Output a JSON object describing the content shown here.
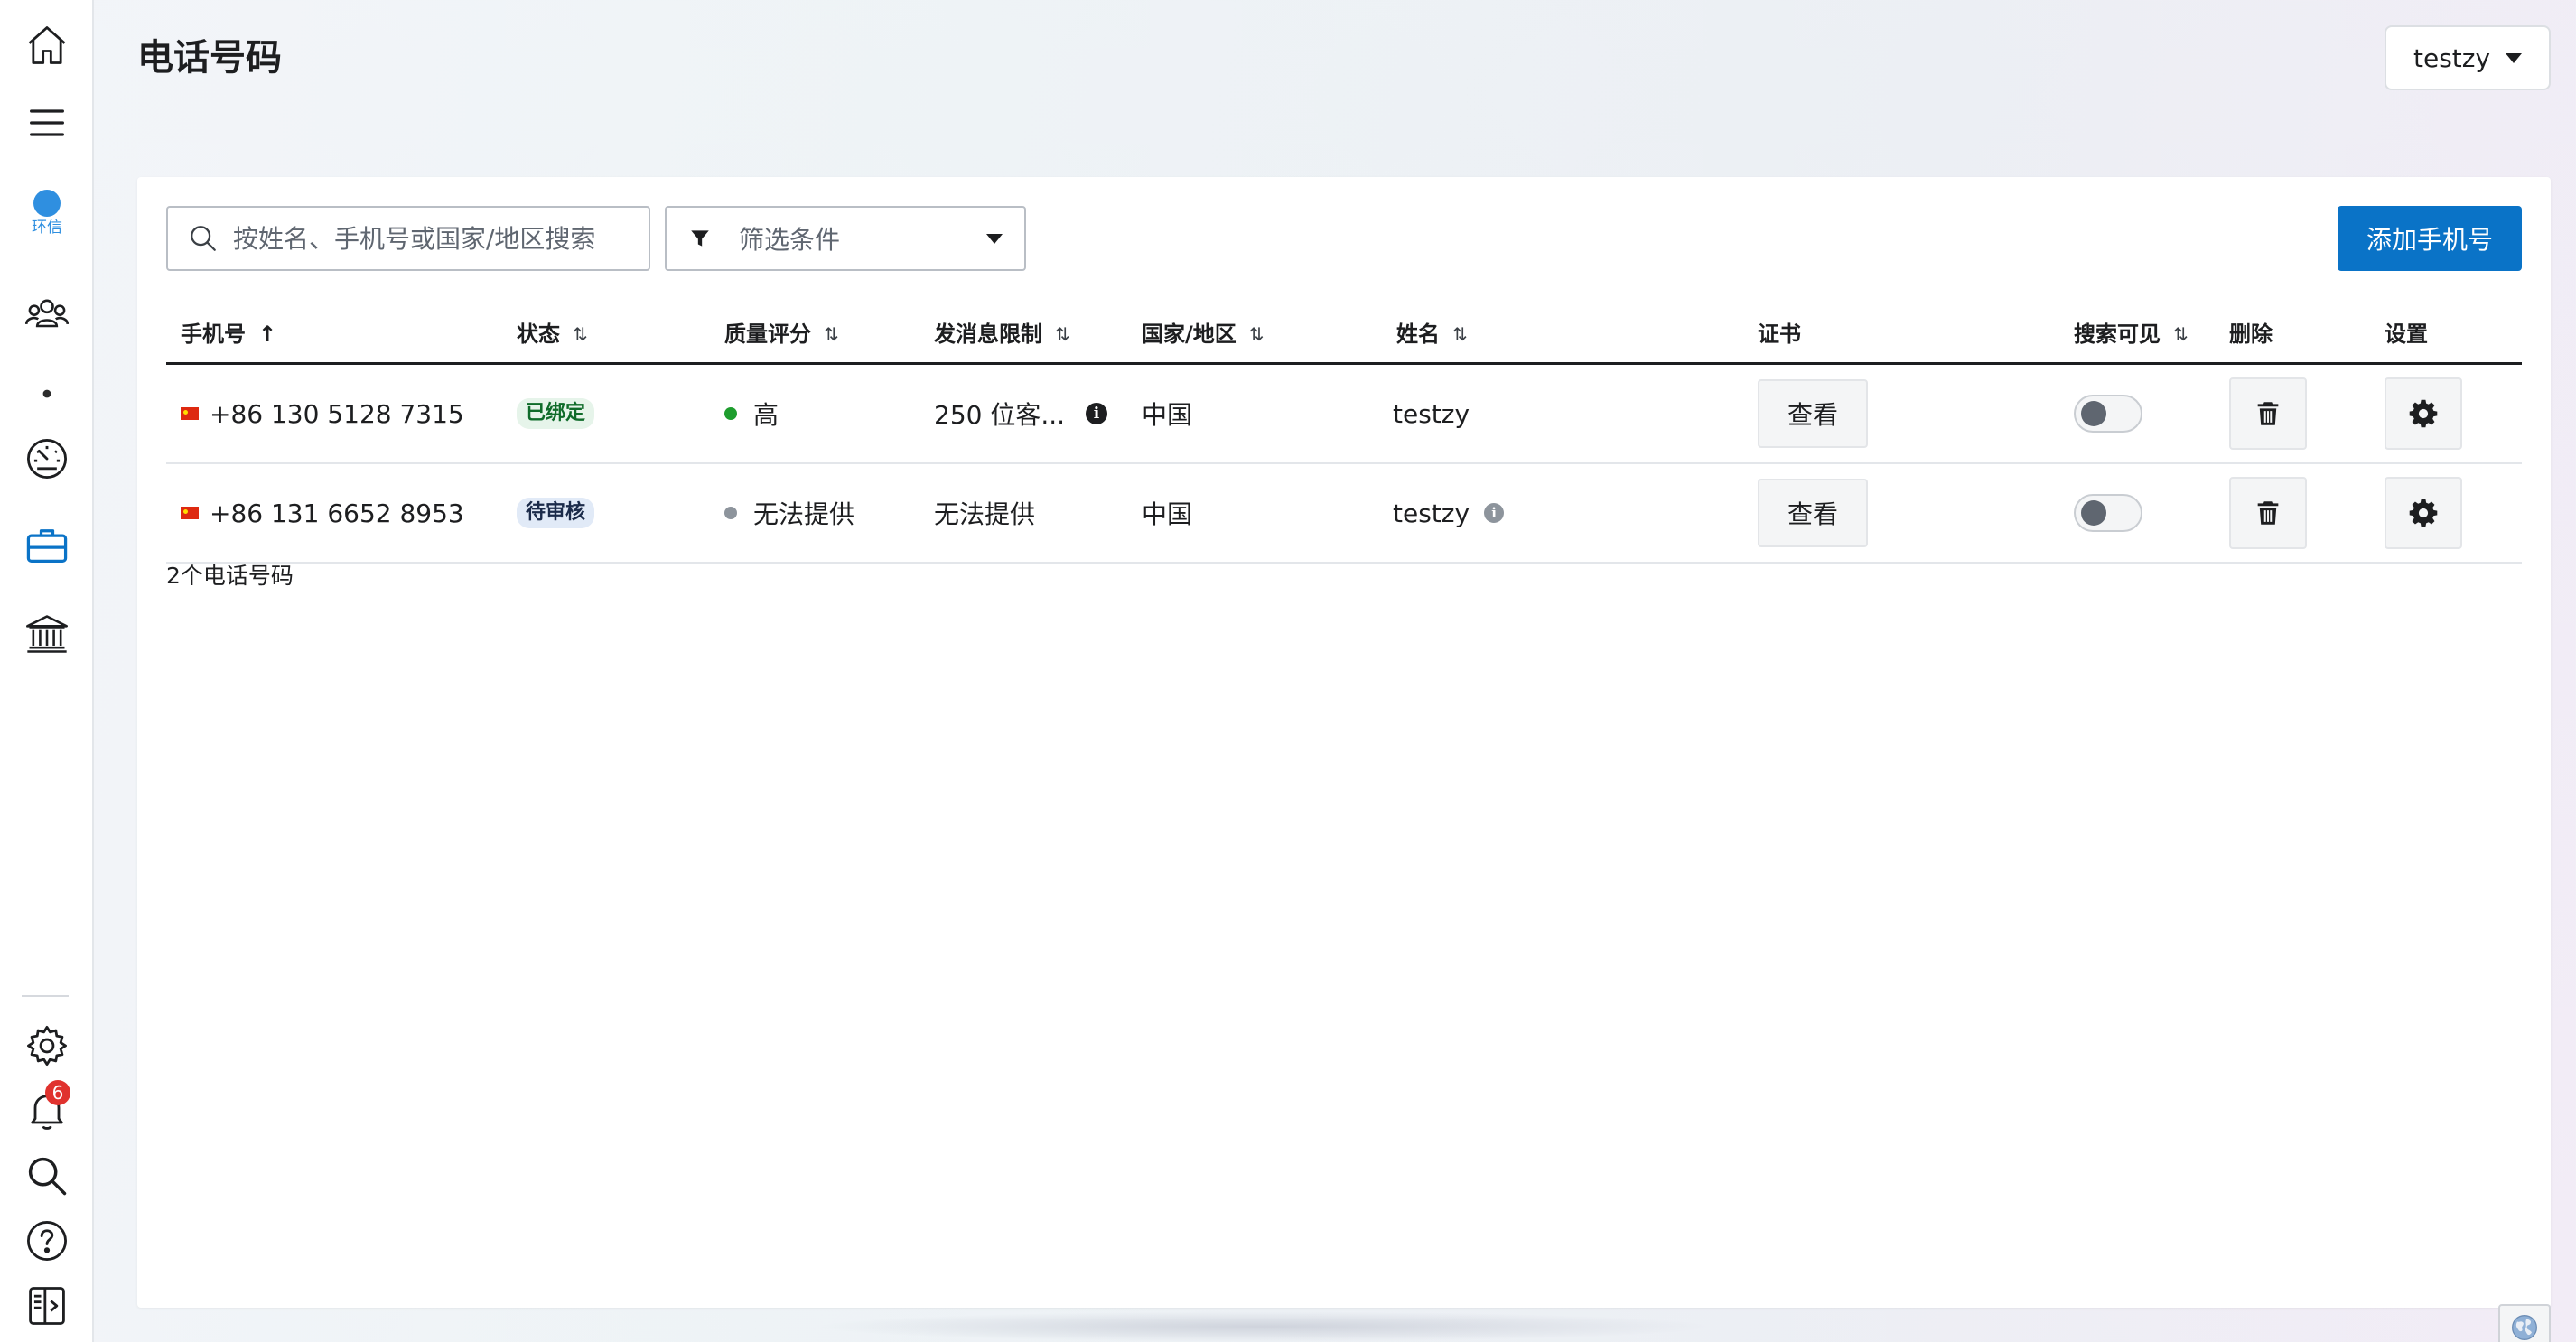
{
  "header": {
    "title": "电话号码",
    "account": "testzy"
  },
  "sidebar": {
    "brand_text": "环信",
    "notification_count": "6",
    "items": [
      {
        "name": "home",
        "icon": "home-icon"
      },
      {
        "name": "menu",
        "icon": "menu-icon"
      },
      {
        "name": "brand",
        "icon": "brand-logo"
      },
      {
        "name": "contacts",
        "icon": "users-icon"
      },
      {
        "name": "dashboard",
        "icon": "gauge-icon"
      },
      {
        "name": "tools",
        "icon": "briefcase-icon"
      },
      {
        "name": "bank",
        "icon": "bank-icon"
      },
      {
        "name": "settings",
        "icon": "gear-icon"
      },
      {
        "name": "notifications",
        "icon": "bell-icon"
      },
      {
        "name": "search",
        "icon": "search-icon"
      },
      {
        "name": "help",
        "icon": "help-icon"
      },
      {
        "name": "toggle-panel",
        "icon": "panel-icon"
      }
    ]
  },
  "toolbar": {
    "search_placeholder": "按姓名、手机号或国家/地区搜索",
    "filter_label": "筛选条件",
    "add_label": "添加手机号"
  },
  "table": {
    "columns": {
      "phone": "手机号",
      "status": "状态",
      "quality": "质量评分",
      "limit": "发消息限制",
      "country": "国家/地区",
      "name": "姓名",
      "cert": "证书",
      "searchable": "搜索可见",
      "delete": "删除",
      "settings": "设置"
    },
    "rows": [
      {
        "phone": "+86 130 5128 7315",
        "status": "已绑定",
        "quality": "高",
        "limit": "250 位客...",
        "country": "中国",
        "name": "testzy",
        "cert_button": "查看",
        "searchable": false
      },
      {
        "phone": "+86 131 6652 8953",
        "status": "待审核",
        "quality": "无法提供",
        "limit": "无法提供",
        "country": "中国",
        "name": "testzy",
        "cert_button": "查看",
        "searchable": false
      }
    ],
    "count_text": "2个电话号码"
  },
  "colors": {
    "primary": "#0a73c7",
    "quality_high": "#1e9d2e",
    "quality_na": "#8d949c",
    "badge": "#e0322e"
  }
}
